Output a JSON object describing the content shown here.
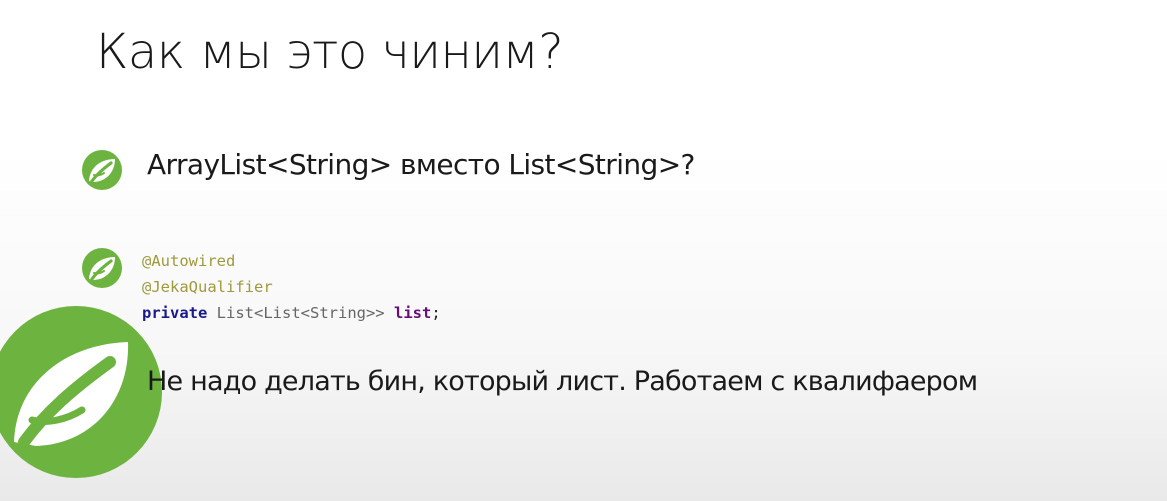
{
  "slide": {
    "title": "Как мы это чиним?",
    "bullets": [
      {
        "text": "ArrayList<String> вместо List<String>?"
      },
      {
        "code": {
          "line1": "@Autowired",
          "line2": "@JekaQualifier",
          "line3_keyword": "private",
          "line3_type": "List<List<String>>",
          "line3_field": "list",
          "line3_end": ";"
        }
      },
      {
        "text": "Не надо делать бин, который лист. Работаем с квалифаером"
      }
    ]
  },
  "colors": {
    "accent_green": "#6db33f",
    "annotation": "#9e9a3c",
    "keyword": "#1a1a8a",
    "field": "#660e7a"
  },
  "icons": {
    "bullet": "spring-leaf-icon",
    "logo": "spring-logo-icon"
  }
}
